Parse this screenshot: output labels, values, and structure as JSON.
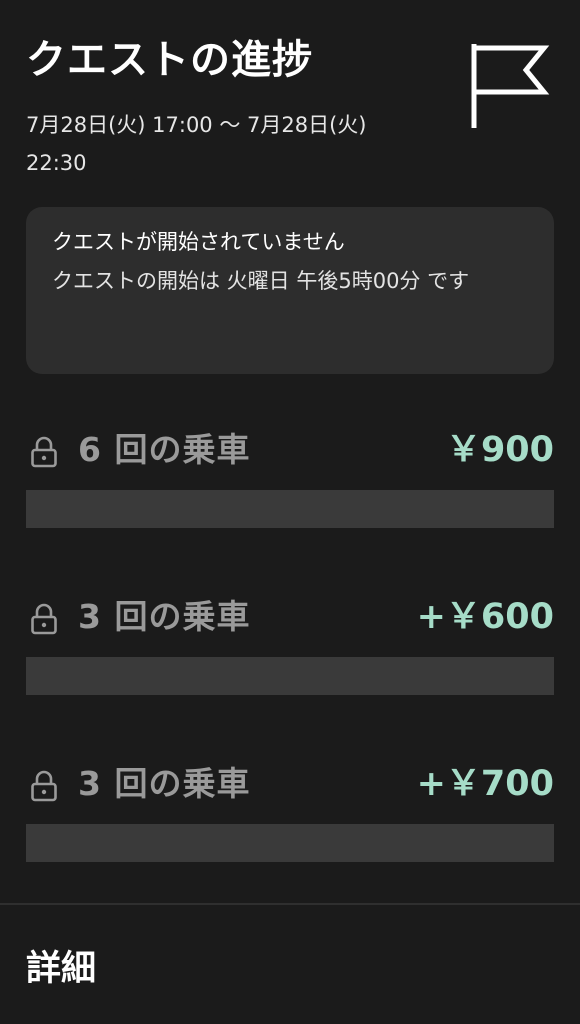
{
  "header": {
    "title": "クエストの進捗",
    "date_range": "7月28日(火) 17:00 〜 7月28日(火) 22:30"
  },
  "notice": {
    "title": "クエストが開始されていません",
    "body": "クエストの開始は 火曜日 午後5時00分 です"
  },
  "quests": [
    {
      "label": "6 回の乗車",
      "reward": "￥900",
      "progress": 0
    },
    {
      "label": "3 回の乗車",
      "reward": "+￥600",
      "progress": 0
    },
    {
      "label": "3 回の乗車",
      "reward": "+￥700",
      "progress": 0
    }
  ],
  "footer": {
    "details_label": "詳細"
  },
  "icons": {
    "header": "flag-icon",
    "quest": "lock-icon"
  },
  "colors": {
    "background": "#1b1b1b",
    "card": "#2d2d2d",
    "reward_accent": "#a6dcc8",
    "locked_text": "#9a9a9a",
    "progress_track": "#3a3a3a"
  }
}
